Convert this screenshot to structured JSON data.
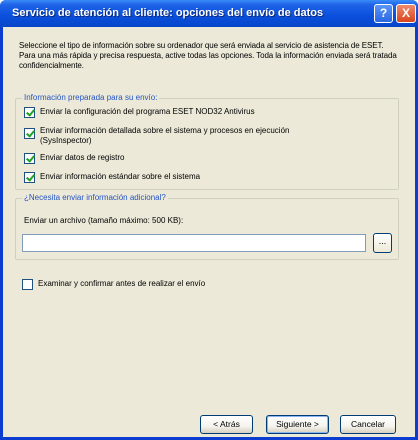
{
  "window": {
    "title": "Servicio de atención al cliente: opciones del envío de datos",
    "help_glyph": "?",
    "close_glyph": "X"
  },
  "intro": "Seleccione el tipo de información sobre su ordenador que será enviada al servicio de asistencia de ESET. Para una más rápida y precisa respuesta, active todas las opciones. Toda la información enviada será tratada confidencialmente.",
  "prepared_group": {
    "legend": "Información preparada para su envío:",
    "items": [
      {
        "label": "Enviar la configuración del programa ESET NOD32 Antivirus",
        "checked": true
      },
      {
        "label": "Enviar información detallada sobre el sistema y procesos en ejecución",
        "label2": "(SysInspector)",
        "checked": true
      },
      {
        "label": "Enviar datos de registro",
        "checked": true
      },
      {
        "label": "Enviar información estándar sobre el sistema",
        "checked": true
      }
    ]
  },
  "additional_group": {
    "legend": "¿Necesita enviar información adicional?",
    "file_label": "Enviar un archivo (tamaño máximo: 500 KB):",
    "file_value": "",
    "browse_label": "..."
  },
  "confirm": {
    "label": "Examinar y confirmar antes de realizar el envío",
    "checked": false
  },
  "buttons": {
    "back": "< Atrás",
    "next": "Siguiente >",
    "cancel": "Cancelar"
  },
  "colors": {
    "title_bar": "#0a4fdc",
    "dialog_bg": "#ece9d8",
    "legend_text": "#2455c4"
  }
}
